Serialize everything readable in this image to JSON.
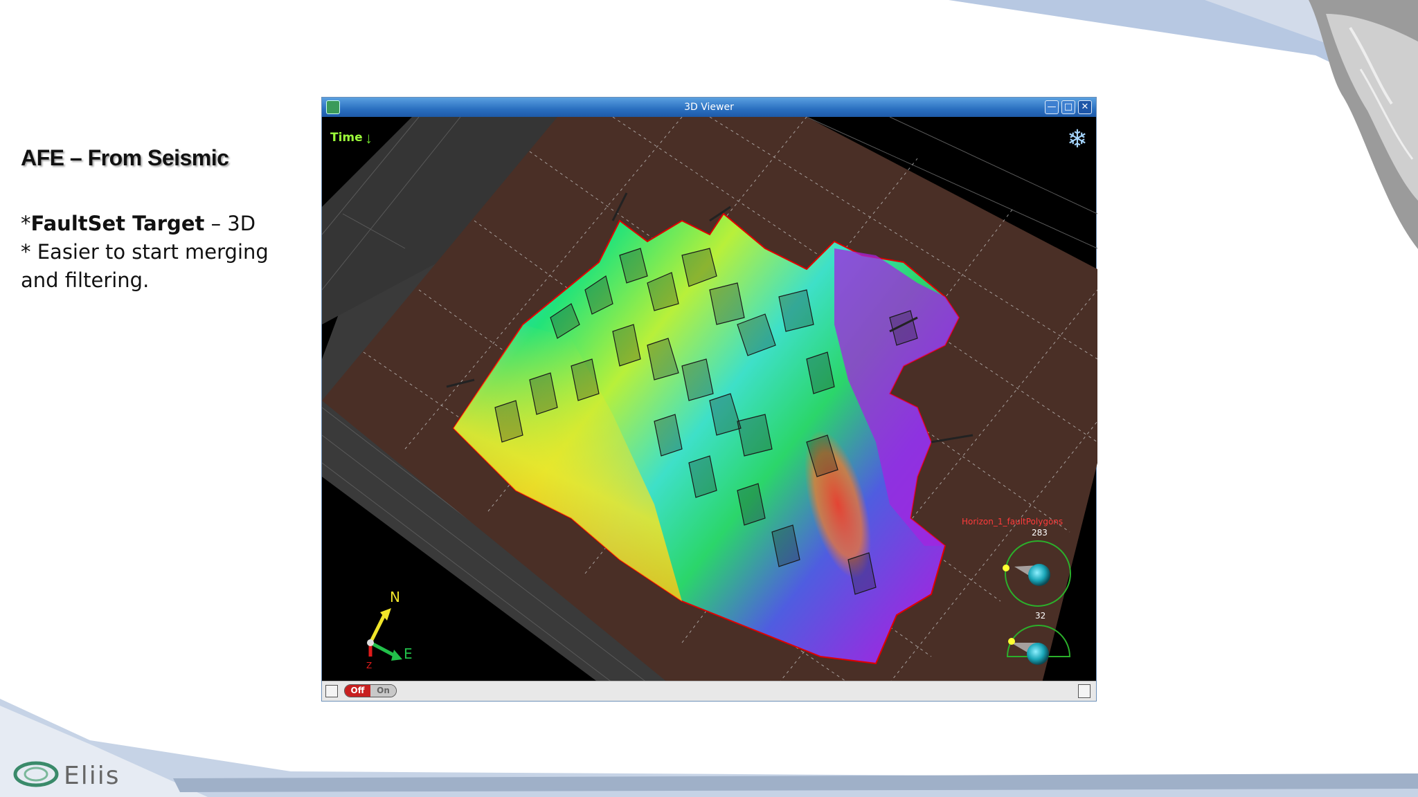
{
  "slide": {
    "title": "AFE – From Seismic",
    "bullet1_prefix": "*",
    "bullet1_bold": "FaultSet Target",
    "bullet1_rest": " – 3D",
    "bullet2": "* Easier to start merging and filtering."
  },
  "logo": {
    "text": "Eliis"
  },
  "viewer": {
    "title": "3D Viewer",
    "time_label": "Time",
    "layer_label": "Horizon_1_faultPolygons",
    "compass_top_value": "283",
    "compass_bottom_value": "32",
    "axis_n": "N",
    "axis_e": "E",
    "axis_z": "Z",
    "toggle_off": "Off",
    "toggle_on": "On",
    "icons": {
      "app": "app-icon",
      "minimize": "minimize-icon",
      "maximize": "maximize-icon",
      "close": "close-icon",
      "time_arrow": "arrow-down-icon",
      "snow": "snowflake-icon",
      "status_left": "toolbar-icon",
      "status_right": "pin-icon"
    }
  },
  "colors": {
    "titlebar": "#2a6fc0",
    "grid_floor": "#4a2f26",
    "horizon_outline": "#e00000",
    "layer_label": "#ff3b3b",
    "compass_ring": "#2bb02b",
    "toggle_off": "#c82020"
  }
}
